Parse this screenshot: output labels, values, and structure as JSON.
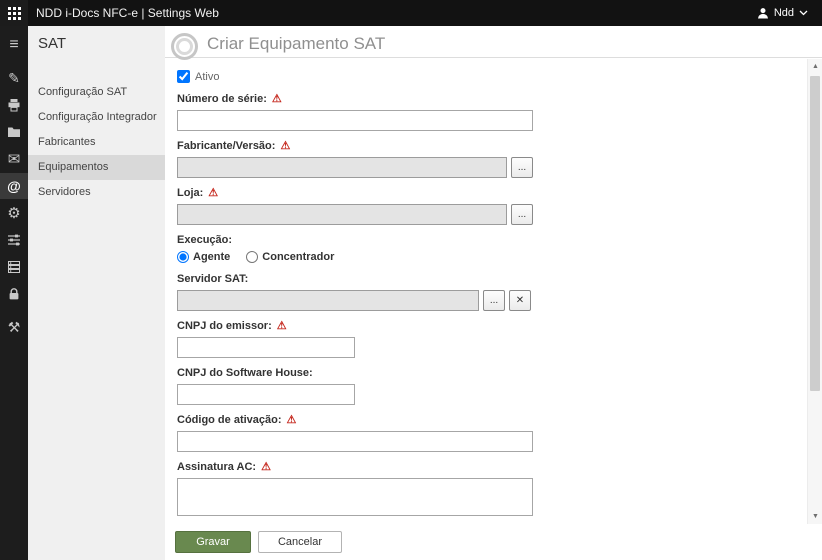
{
  "topbar": {
    "title": "NDD i-Docs NFC-e | Settings Web",
    "user_label": "Ndd"
  },
  "iconbar": {
    "active_index": 5,
    "items": [
      {
        "name": "menu-icon"
      },
      {
        "name": "pen-tool-icon"
      },
      {
        "name": "printer-icon"
      },
      {
        "name": "folder-icon"
      },
      {
        "name": "mail-icon"
      },
      {
        "name": "at-icon"
      },
      {
        "name": "gear-icon"
      },
      {
        "name": "sliders-icon"
      },
      {
        "name": "server-icon"
      },
      {
        "name": "lock-icon"
      },
      {
        "name": "wrench-icon"
      }
    ]
  },
  "sidebar": {
    "title": "SAT",
    "active_index": 3,
    "items": [
      {
        "label": "Configuração SAT"
      },
      {
        "label": "Configuração Integrador"
      },
      {
        "label": "Fabricantes"
      },
      {
        "label": "Equipamentos"
      },
      {
        "label": "Servidores"
      }
    ]
  },
  "main": {
    "title": "Criar Equipamento SAT"
  },
  "form": {
    "ativo": {
      "label": "Ativo",
      "checked": true
    },
    "numero_serie": {
      "label": "Número de série:",
      "required": true,
      "value": ""
    },
    "fabricante": {
      "label": "Fabricante/Versão:",
      "required": true,
      "value": "",
      "disabled": true
    },
    "loja": {
      "label": "Loja:",
      "required": true,
      "value": "",
      "disabled": true
    },
    "execucao": {
      "label": "Execução:",
      "options": [
        "Agente",
        "Concentrador"
      ],
      "selected": "Agente"
    },
    "servidor": {
      "label": "Servidor SAT:",
      "required": false,
      "value": "",
      "disabled": true
    },
    "cnpj_emissor": {
      "label": "CNPJ do emissor:",
      "required": true,
      "value": ""
    },
    "cnpj_software": {
      "label": "CNPJ do Software House:",
      "required": false,
      "value": ""
    },
    "codigo_ativacao": {
      "label": "Código de ativação:",
      "required": true,
      "value": ""
    },
    "assinatura": {
      "label": "Assinatura AC:",
      "required": true,
      "value": ""
    }
  },
  "footer": {
    "save": "Gravar",
    "cancel": "Cancelar"
  },
  "ui": {
    "required_marker": "⚠",
    "picker": "...",
    "clear": "✕",
    "scroll_up": "▲",
    "scroll_down": "▼"
  },
  "colors": {
    "accent_green": "#69894f",
    "required_red": "#c62b21",
    "topbar_bg": "#121212",
    "rail_bg": "#1d1d1d",
    "sidebar_bg": "#f0f0f0",
    "sidebar_active": "#d9d9d9"
  }
}
